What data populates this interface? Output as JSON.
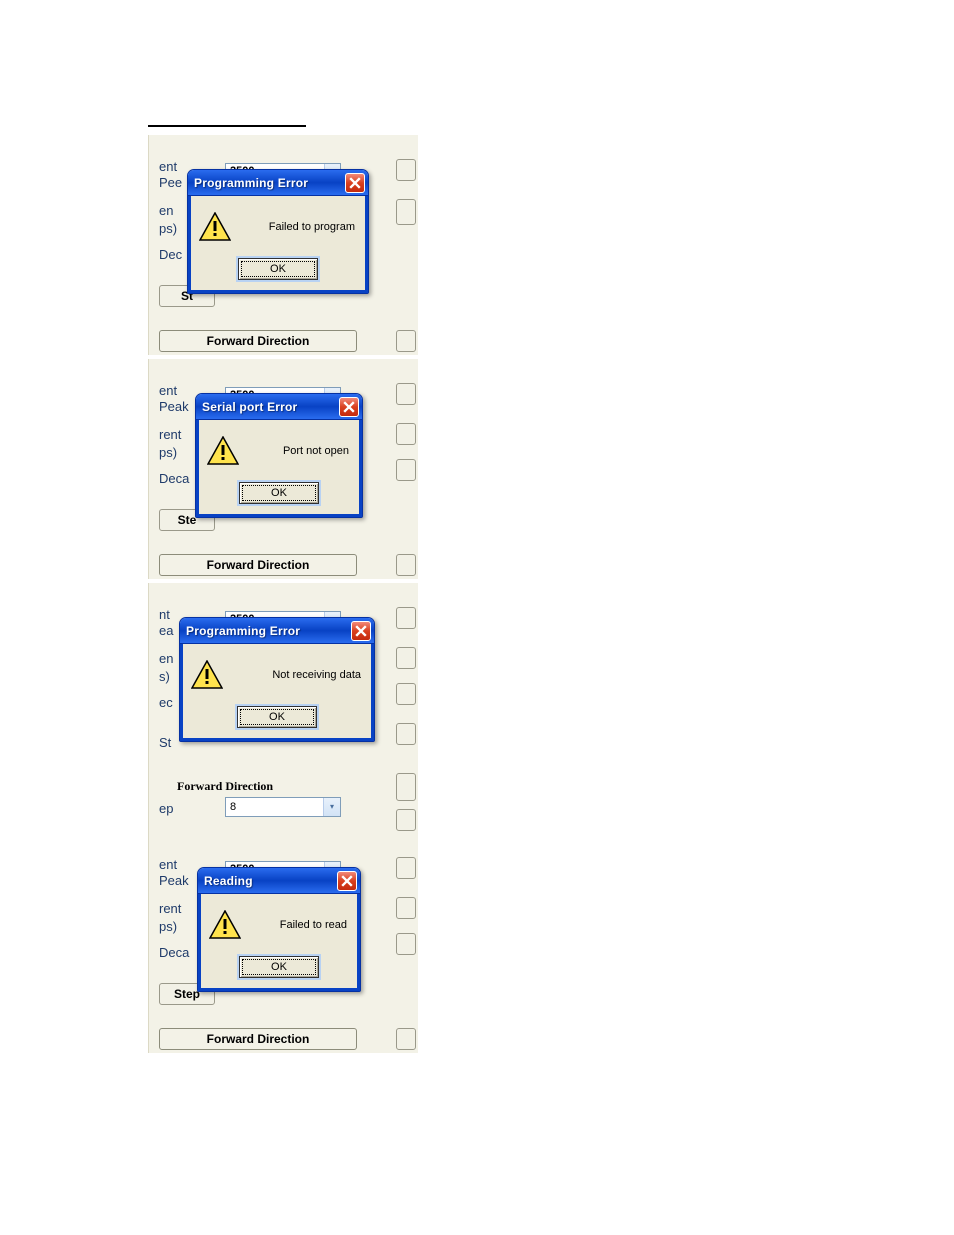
{
  "panel1": {
    "labels": [
      "ent",
      "Pee",
      "en",
      "ps)",
      "Dec",
      "St"
    ],
    "combo_value": "2500",
    "fwd_btn": "Forward Direction"
  },
  "panel2": {
    "labels": [
      "ent",
      "Peak",
      "rent",
      "ps)",
      "Deca",
      "Ste"
    ],
    "combo_value": "2500",
    "fwd_btn": "Forward Direction"
  },
  "panel3": {
    "labels": [
      "nt",
      "ea",
      "en",
      "s)",
      "ec",
      "St"
    ],
    "combo_value": "2500",
    "fwd_btn": "Forward Direction",
    "ep_label": "ep",
    "ep_value": "8"
  },
  "panel4": {
    "labels": [
      "ent",
      "Peak",
      "rent",
      "ps)",
      "Deca",
      "Step"
    ],
    "combo_value": "2500",
    "fwd_btn": "Forward Direction"
  },
  "dlg1": {
    "title": "Programming Error",
    "message": "Failed to program",
    "ok": "OK"
  },
  "dlg2": {
    "title": "Serial port Error",
    "message": "Port not open",
    "ok": "OK"
  },
  "dlg3": {
    "title": "Programming Error",
    "message": "Not receiving data",
    "ok": "OK"
  },
  "dlg4": {
    "title": "Reading",
    "message": "Failed to read",
    "ok": "OK"
  }
}
